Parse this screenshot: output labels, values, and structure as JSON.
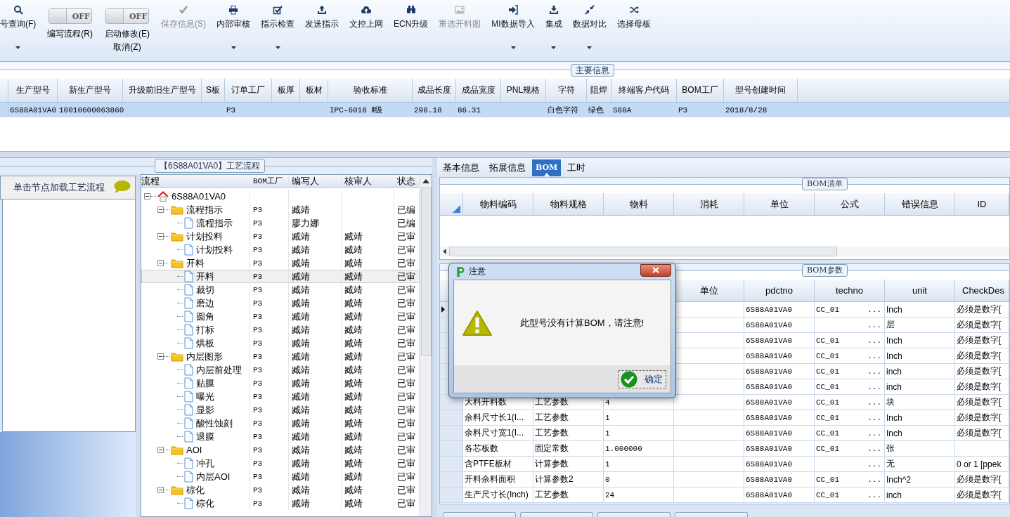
{
  "toolbar": {
    "items": [
      {
        "kind": "button",
        "label": "号查询(F)",
        "dropdown": true,
        "disabled": false
      },
      {
        "kind": "toggle",
        "label": "编写流程(R)",
        "state_text": "OFF",
        "on": false
      },
      {
        "kind": "toggle",
        "label": "启动修改(E)",
        "sublabel": "取消(Z)",
        "state_text": "OFF",
        "on": false
      },
      {
        "kind": "button",
        "label": "保存信息(S)",
        "dropdown": false,
        "disabled": true
      },
      {
        "kind": "button",
        "label": "内部审核",
        "dropdown": true,
        "disabled": false
      },
      {
        "kind": "button",
        "label": "指示检查",
        "dropdown": true,
        "disabled": false
      },
      {
        "kind": "button",
        "label": "发送指示",
        "dropdown": false,
        "disabled": false
      },
      {
        "kind": "button",
        "label": "文控上网",
        "dropdown": false,
        "disabled": false
      },
      {
        "kind": "button",
        "label": "ECN升级",
        "dropdown": false,
        "disabled": false
      },
      {
        "kind": "button",
        "label": "重选开料图",
        "dropdown": false,
        "disabled": true
      },
      {
        "kind": "button",
        "label": "MI数据导入",
        "dropdown": true,
        "disabled": false
      },
      {
        "kind": "button",
        "label": "集成",
        "dropdown": true,
        "disabled": false
      },
      {
        "kind": "button",
        "label": "数据对比",
        "dropdown": true,
        "disabled": false
      },
      {
        "kind": "button",
        "label": "选择母板",
        "dropdown": false,
        "disabled": false
      }
    ]
  },
  "main_info": {
    "title": "主要信息",
    "row_selected": true,
    "columns": [
      {
        "label": "生产型号",
        "value": "6S88A01VA0"
      },
      {
        "label": "新生产型号",
        "value": "10010600063860"
      },
      {
        "label": "升级前旧生产型号"
      },
      {
        "label": "S板"
      },
      {
        "label": "订单工厂",
        "value": "P3"
      },
      {
        "label": "板厚"
      },
      {
        "label": "板材"
      },
      {
        "label": "验收标准",
        "value": "IPC-6018 Ⅱ级"
      },
      {
        "label": "成品长度",
        "value": "298.18"
      },
      {
        "label": "成品宽度",
        "value": "86.31"
      },
      {
        "label": "PNL规格"
      },
      {
        "label": "字符",
        "value": "白色字符"
      },
      {
        "label": "阻焊",
        "value": "绿色"
      },
      {
        "label": "终端客户代码",
        "value": "S88A"
      },
      {
        "label": "BOM工厂",
        "value": "P3"
      },
      {
        "label": "型号创建时间",
        "value": "2018/8/28"
      }
    ]
  },
  "process_flow": {
    "title": "【6S88A01VA0】工艺流程",
    "hint": "单击节点加载工艺流程",
    "columns": [
      "流程",
      "BOM工厂",
      "编写人",
      "核审人",
      "状态"
    ],
    "tree": [
      {
        "label": "6S88A01VA0",
        "kind": "root",
        "selected": false,
        "expanded": true,
        "children": [
          {
            "label": "流程指示",
            "kind": "folder",
            "bom_factory": "P3",
            "writer": "臧靖",
            "status": "已编",
            "selected": false,
            "expanded": true,
            "children": [
              {
                "label": "流程指示",
                "kind": "file",
                "bom_factory": "P3",
                "writer": "廖力娜",
                "status": "已编",
                "selected": false
              }
            ]
          },
          {
            "label": "计划投料",
            "kind": "folder",
            "bom_factory": "P3",
            "writer": "臧靖",
            "reviewer": "臧靖",
            "status": "已审",
            "selected": false,
            "expanded": true,
            "children": [
              {
                "label": "计划投料",
                "kind": "file",
                "bom_factory": "P3",
                "writer": "臧靖",
                "reviewer": "臧靖",
                "status": "已审",
                "selected": false
              }
            ]
          },
          {
            "label": "开料",
            "kind": "folder",
            "bom_factory": "P3",
            "writer": "臧靖",
            "reviewer": "臧靖",
            "status": "已审",
            "selected": false,
            "expanded": true,
            "children": [
              {
                "label": "开料",
                "kind": "file",
                "bom_factory": "P3",
                "writer": "臧靖",
                "reviewer": "臧靖",
                "status": "已审",
                "selected": true
              },
              {
                "label": "裁切",
                "kind": "file",
                "bom_factory": "P3",
                "writer": "臧靖",
                "reviewer": "臧靖",
                "status": "已审",
                "selected": false
              },
              {
                "label": "磨边",
                "kind": "file",
                "bom_factory": "P3",
                "writer": "臧靖",
                "reviewer": "臧靖",
                "status": "已审",
                "selected": false
              },
              {
                "label": "圆角",
                "kind": "file",
                "bom_factory": "P3",
                "writer": "臧靖",
                "reviewer": "臧靖",
                "status": "已审",
                "selected": false
              },
              {
                "label": "打标",
                "kind": "file",
                "bom_factory": "P3",
                "writer": "臧靖",
                "reviewer": "臧靖",
                "status": "已审",
                "selected": false
              },
              {
                "label": "烘板",
                "kind": "file",
                "bom_factory": "P3",
                "writer": "臧靖",
                "reviewer": "臧靖",
                "status": "已审",
                "selected": false
              }
            ]
          },
          {
            "label": "内层图形",
            "kind": "folder",
            "bom_factory": "P3",
            "writer": "臧靖",
            "reviewer": "臧靖",
            "status": "已审",
            "selected": false,
            "expanded": true,
            "children": [
              {
                "label": "内层前处理",
                "kind": "file",
                "bom_factory": "P3",
                "writer": "臧靖",
                "reviewer": "臧靖",
                "status": "已审",
                "selected": false
              },
              {
                "label": "贴膜",
                "kind": "file",
                "bom_factory": "P3",
                "writer": "臧靖",
                "reviewer": "臧靖",
                "status": "已审",
                "selected": false
              },
              {
                "label": "曝光",
                "kind": "file",
                "bom_factory": "P3",
                "writer": "臧靖",
                "reviewer": "臧靖",
                "status": "已审",
                "selected": false
              },
              {
                "label": "显影",
                "kind": "file",
                "bom_factory": "P3",
                "writer": "臧靖",
                "reviewer": "臧靖",
                "status": "已审",
                "selected": false
              },
              {
                "label": "酸性蚀刻",
                "kind": "file",
                "bom_factory": "P3",
                "writer": "臧靖",
                "reviewer": "臧靖",
                "status": "已审",
                "selected": false
              },
              {
                "label": "退膜",
                "kind": "file",
                "bom_factory": "P3",
                "writer": "臧靖",
                "reviewer": "臧靖",
                "status": "已审",
                "selected": false
              }
            ]
          },
          {
            "label": "AOI",
            "kind": "folder",
            "bom_factory": "P3",
            "writer": "臧靖",
            "reviewer": "臧靖",
            "status": "已审",
            "selected": false,
            "expanded": true,
            "children": [
              {
                "label": "冲孔",
                "kind": "file",
                "bom_factory": "P3",
                "writer": "臧靖",
                "reviewer": "臧靖",
                "status": "已审",
                "selected": false
              },
              {
                "label": "内层AOI",
                "kind": "file",
                "bom_factory": "P3",
                "writer": "臧靖",
                "reviewer": "臧靖",
                "status": "已审",
                "selected": false
              }
            ]
          },
          {
            "label": "棕化",
            "kind": "folder",
            "bom_factory": "P3",
            "writer": "臧靖",
            "reviewer": "臧靖",
            "status": "已审",
            "selected": false,
            "expanded": true,
            "children": [
              {
                "label": "棕化",
                "kind": "file",
                "bom_factory": "P3",
                "writer": "臧靖",
                "reviewer": "臧靖",
                "status": "已审",
                "selected": false
              }
            ]
          }
        ]
      }
    ]
  },
  "tabs": [
    {
      "label": "基本信息",
      "selected": false
    },
    {
      "label": "拓展信息",
      "selected": false
    },
    {
      "label": "BOM",
      "selected": true
    },
    {
      "label": "工时",
      "selected": false
    }
  ],
  "bom_list": {
    "title": "BOM清单",
    "columns": [
      "物料编码",
      "物料规格",
      "物料",
      "消耗",
      "单位",
      "公式",
      "错误信息",
      "ID"
    ]
  },
  "bom_params": {
    "title": "BOM参数",
    "columns": [
      "单位",
      "pdctno",
      "techno",
      "unit",
      "CheckDes"
    ],
    "rows": [
      {
        "current": true,
        "pdctno": "6S88A01VA0",
        "techno": "CC_01",
        "techno_button": "...",
        "unit": "Inch",
        "check": "必须是数字["
      },
      {
        "current": false,
        "pdctno": "6S88A01VA0",
        "techno_button": "...",
        "unit": "层",
        "check": "必须是数字["
      },
      {
        "current": false,
        "pdctno": "6S88A01VA0",
        "techno": "CC_01",
        "techno_button": "...",
        "unit": "Inch",
        "check": "必须是数字["
      },
      {
        "current": false,
        "pdctno": "6S88A01VA0",
        "techno": "CC_01",
        "techno_button": "...",
        "unit": "Inch",
        "check": "必须是数字["
      },
      {
        "current": false,
        "pdctno": "6S88A01VA0",
        "techno": "CC_01",
        "techno_button": "...",
        "unit": "inch",
        "check": "必须是数字["
      },
      {
        "current": false,
        "pdctno": "6S88A01VA0",
        "techno": "CC_01",
        "techno_button": "...",
        "unit": "inch",
        "check": "必须是数字["
      },
      {
        "current": false,
        "item": "大料开料数",
        "category": "工艺参数",
        "value": "4",
        "pdctno": "6S88A01VA0",
        "techno": "CC_01",
        "techno_button": "...",
        "unit": "块",
        "check": "必须是数字["
      },
      {
        "current": false,
        "item": "余料尺寸长1(I...",
        "category": "工艺参数",
        "value": "1",
        "pdctno": "6S88A01VA0",
        "techno": "CC_01",
        "techno_button": "...",
        "unit": "Inch",
        "check": "必须是数字["
      },
      {
        "current": false,
        "item": "余料尺寸宽1(I...",
        "category": "工艺参数",
        "value": "1",
        "pdctno": "6S88A01VA0",
        "techno": "CC_01",
        "techno_button": "...",
        "unit": "Inch",
        "check": "必须是数字["
      },
      {
        "current": false,
        "item": "各芯板数",
        "category": "固定常数",
        "value": "1.000000",
        "pdctno": "6S88A01VA0",
        "techno": "CC_01",
        "techno_button": "...",
        "unit": "张"
      },
      {
        "current": false,
        "item": "含PTFE板材",
        "category": "计算参数",
        "value": "1",
        "pdctno": "6S88A01VA0",
        "techno_button": "...",
        "unit": "无",
        "check": "0 or 1 [ppek"
      },
      {
        "current": false,
        "item": "开料余料面积",
        "category": "计算参数2",
        "value": "0",
        "pdctno": "6S88A01VA0",
        "techno": "CC_01",
        "techno_button": "...",
        "unit": "Inch^2",
        "check": "必须是数字["
      },
      {
        "current": false,
        "item": "生产尺寸长(Inch)",
        "category": "工艺参数",
        "value": "24",
        "pdctno": "6S88A01VA0",
        "techno": "CC_01",
        "techno_button": "...",
        "unit": "inch",
        "check": "必须是数字["
      }
    ]
  },
  "dialog": {
    "title": "注意",
    "message": "此型号没有计算BOM，请注意!",
    "button": "确定"
  }
}
